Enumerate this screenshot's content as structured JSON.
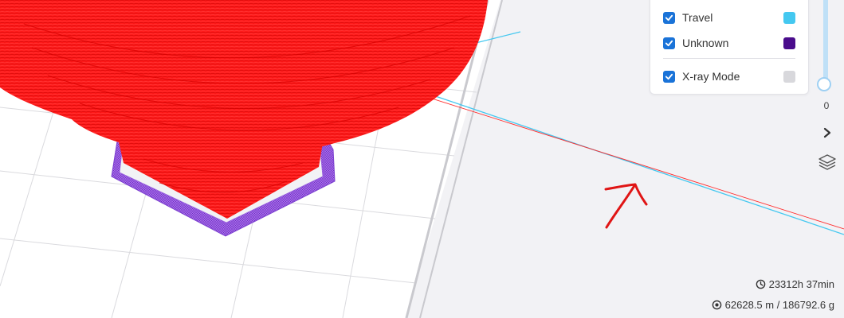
{
  "legend": {
    "items": [
      {
        "label": "Travel",
        "checked": true,
        "color": "#44c8f0"
      },
      {
        "label": "Unknown",
        "checked": true,
        "color": "#4a0c8c"
      },
      {
        "label": "X-ray Mode",
        "checked": true,
        "color": "#d8d8dc"
      }
    ]
  },
  "layer_slider": {
    "value": "0"
  },
  "stats": {
    "print_time": "23312h 37min",
    "filament": "62628.5 m / 186792.6 g"
  },
  "colors": {
    "accent": "#1a73d8",
    "model_red": "#ff1a1a",
    "skirt_purple": "#9f5fe6",
    "travel_cyan": "#44c8f0",
    "annotation_red": "#e01515"
  }
}
